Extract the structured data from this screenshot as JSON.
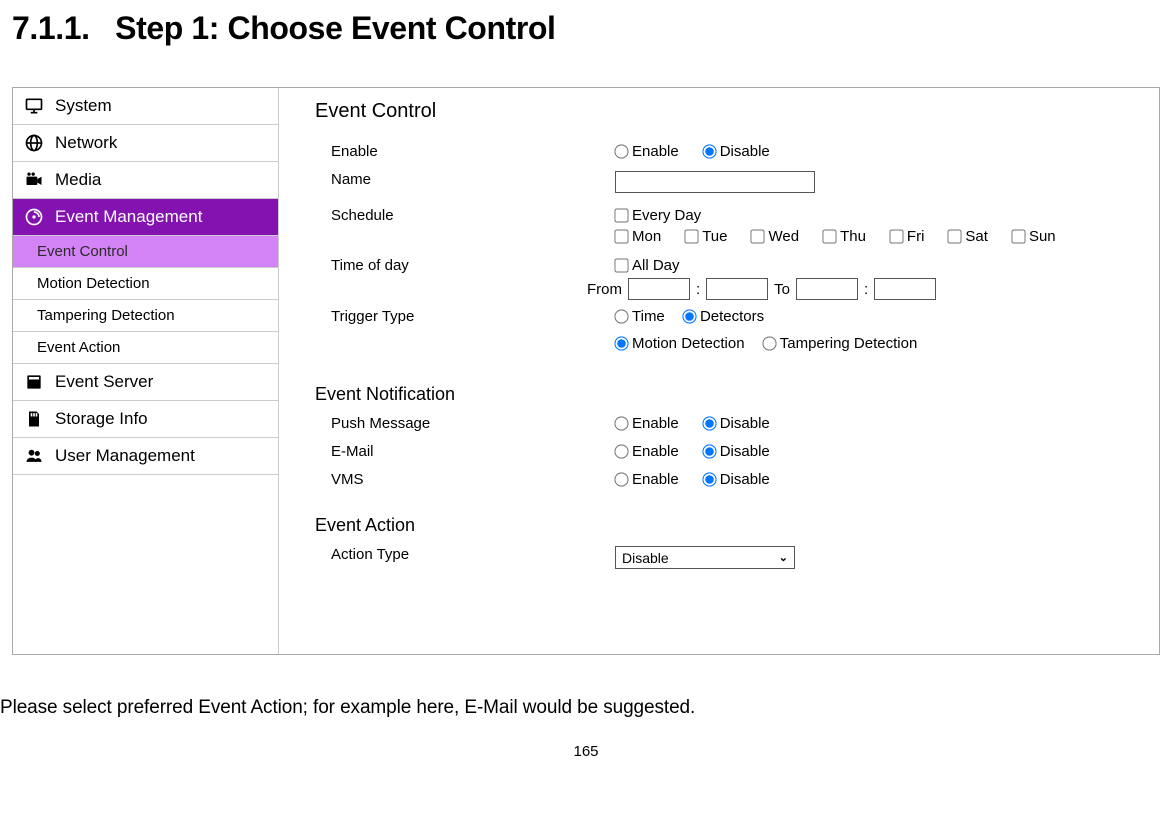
{
  "doc": {
    "heading_number": "7.1.1.",
    "heading_text": "Step 1: Choose Event Control",
    "body_text": "Please select preferred Event Action; for example here, E-Mail would be suggested.",
    "page_number": "165"
  },
  "sidebar": {
    "items": [
      {
        "label": "System",
        "type": "top"
      },
      {
        "label": "Network",
        "type": "top"
      },
      {
        "label": "Media",
        "type": "top"
      },
      {
        "label": "Event Management",
        "type": "top-selected"
      },
      {
        "label": "Event Control",
        "type": "sub-selected"
      },
      {
        "label": "Motion Detection",
        "type": "sub"
      },
      {
        "label": "Tampering Detection",
        "type": "sub"
      },
      {
        "label": "Event Action",
        "type": "sub"
      },
      {
        "label": "Event Server",
        "type": "top"
      },
      {
        "label": "Storage Info",
        "type": "top"
      },
      {
        "label": "User Management",
        "type": "top"
      }
    ]
  },
  "main": {
    "title": "Event Control",
    "enable": {
      "label": "Enable",
      "opt_enable": "Enable",
      "opt_disable": "Disable"
    },
    "name": {
      "label": "Name",
      "value": ""
    },
    "schedule": {
      "label": "Schedule",
      "every_day": "Every Day",
      "days": [
        "Mon",
        "Tue",
        "Wed",
        "Thu",
        "Fri",
        "Sat",
        "Sun"
      ]
    },
    "timeofday": {
      "label": "Time of day",
      "all_day": "All Day",
      "from": "From",
      "to": "To",
      "colon": ":"
    },
    "trigger": {
      "label": "Trigger Type",
      "time": "Time",
      "detectors": "Detectors",
      "motion": "Motion Detection",
      "tamper": "Tampering Detection"
    },
    "notification": {
      "heading": "Event Notification",
      "rows": [
        {
          "label": "Push Message",
          "enable": "Enable",
          "disable": "Disable"
        },
        {
          "label": "E-Mail",
          "enable": "Enable",
          "disable": "Disable"
        },
        {
          "label": "VMS",
          "enable": "Enable",
          "disable": "Disable"
        }
      ]
    },
    "action": {
      "heading": "Event Action",
      "label": "Action Type",
      "value": "Disable"
    }
  }
}
